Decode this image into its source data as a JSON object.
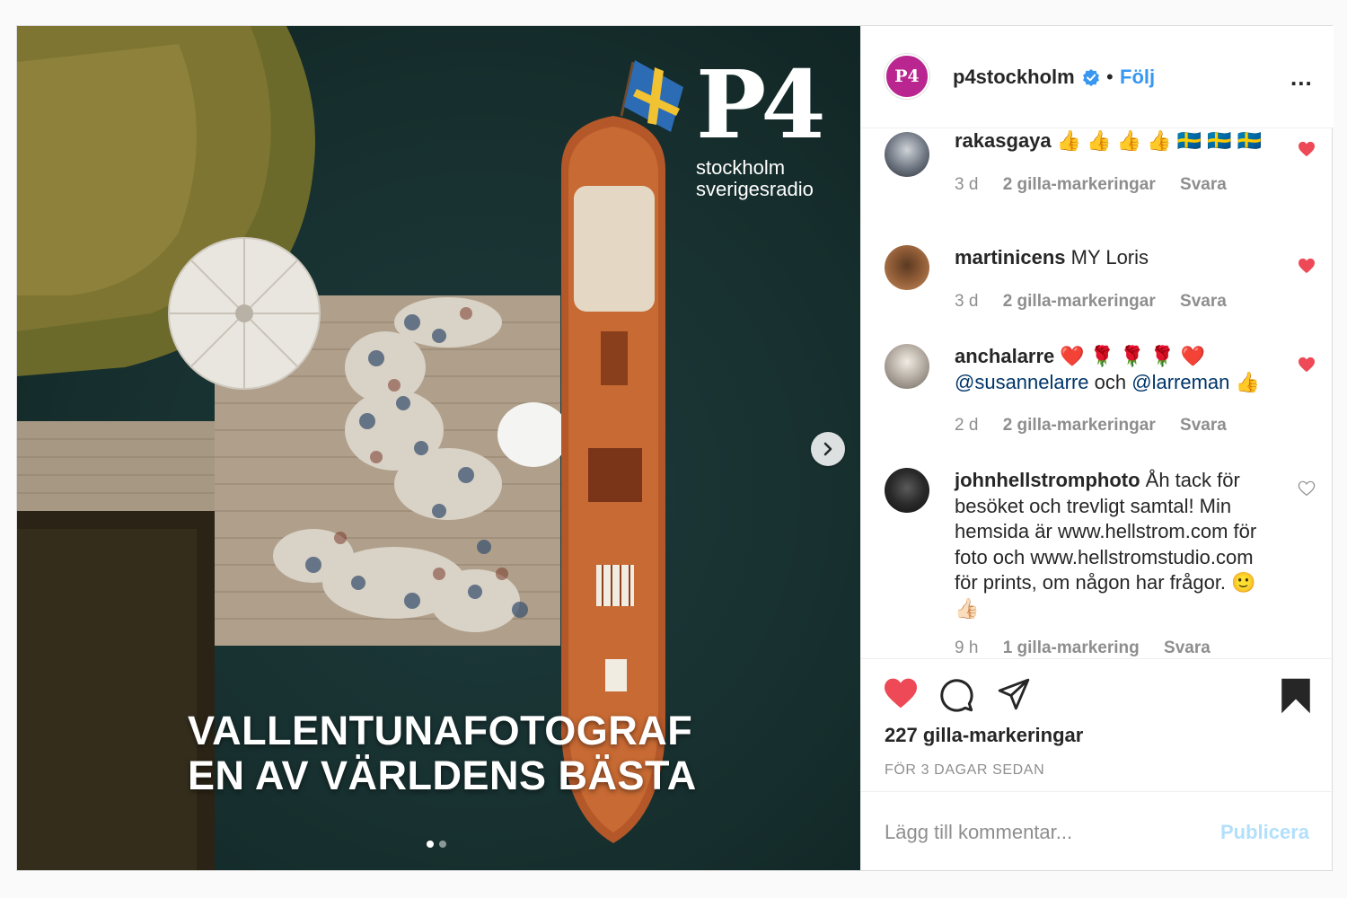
{
  "post": {
    "image": {
      "overlay_lines": [
        "VALLENTUNAFOTOGRAF",
        "EN AV VÄRLDENS BÄSTA"
      ],
      "logo_mark": "P4",
      "logo_lines": [
        "stockholm",
        "sverigesradio"
      ],
      "carousel_count": 2,
      "carousel_active": 1
    },
    "header": {
      "username": "p4stockholm",
      "verified": true,
      "separator": "•",
      "follow_label": "Följ",
      "avatar_text": "P4",
      "more_label": "..."
    },
    "comments": [
      {
        "username": "rakasgaya",
        "text": "👍 👍 👍 👍 🇸🇪 🇸🇪 🇸🇪",
        "time": "3 d",
        "likes": "2 gilla-markeringar",
        "reply": "Svara",
        "liked": true
      },
      {
        "username": "martinicens",
        "text": "MY Loris",
        "time": "3 d",
        "likes": "2 gilla-markeringar",
        "reply": "Svara",
        "liked": true
      },
      {
        "username": "anchalarre",
        "text": "❤️ 🌹 🌹 🌹 ❤️",
        "mention1": "@susannelarre",
        "conj": "och",
        "mention2": "@larreman",
        "emoji_tail": "👍",
        "time": "2 d",
        "likes": "2 gilla-markeringar",
        "reply": "Svara",
        "liked": true
      },
      {
        "username": "johnhellstromphoto",
        "text": "Åh tack för besöket och trevligt samtal! Min hemsida är www.hellstrom.com för foto och www.hellstromstudio.com för prints, om någon har frågor. 🙂 👍🏻",
        "time": "9 h",
        "likes": "1 gilla-markering",
        "reply": "Svara",
        "liked": false
      }
    ],
    "actions": {
      "likes_count": "227 gilla-markeringar",
      "posted_ago": "FÖR 3 DAGAR SEDAN",
      "liked": true,
      "saved": true
    },
    "add_comment": {
      "placeholder": "Lägg till kommentar...",
      "post_label": "Publicera"
    },
    "colors": {
      "like_red": "#ed4956",
      "link_blue": "#3897f0",
      "mention_blue": "#003569",
      "muted": "#8e8e8e",
      "publish_disabled": "#b2dffc"
    }
  }
}
